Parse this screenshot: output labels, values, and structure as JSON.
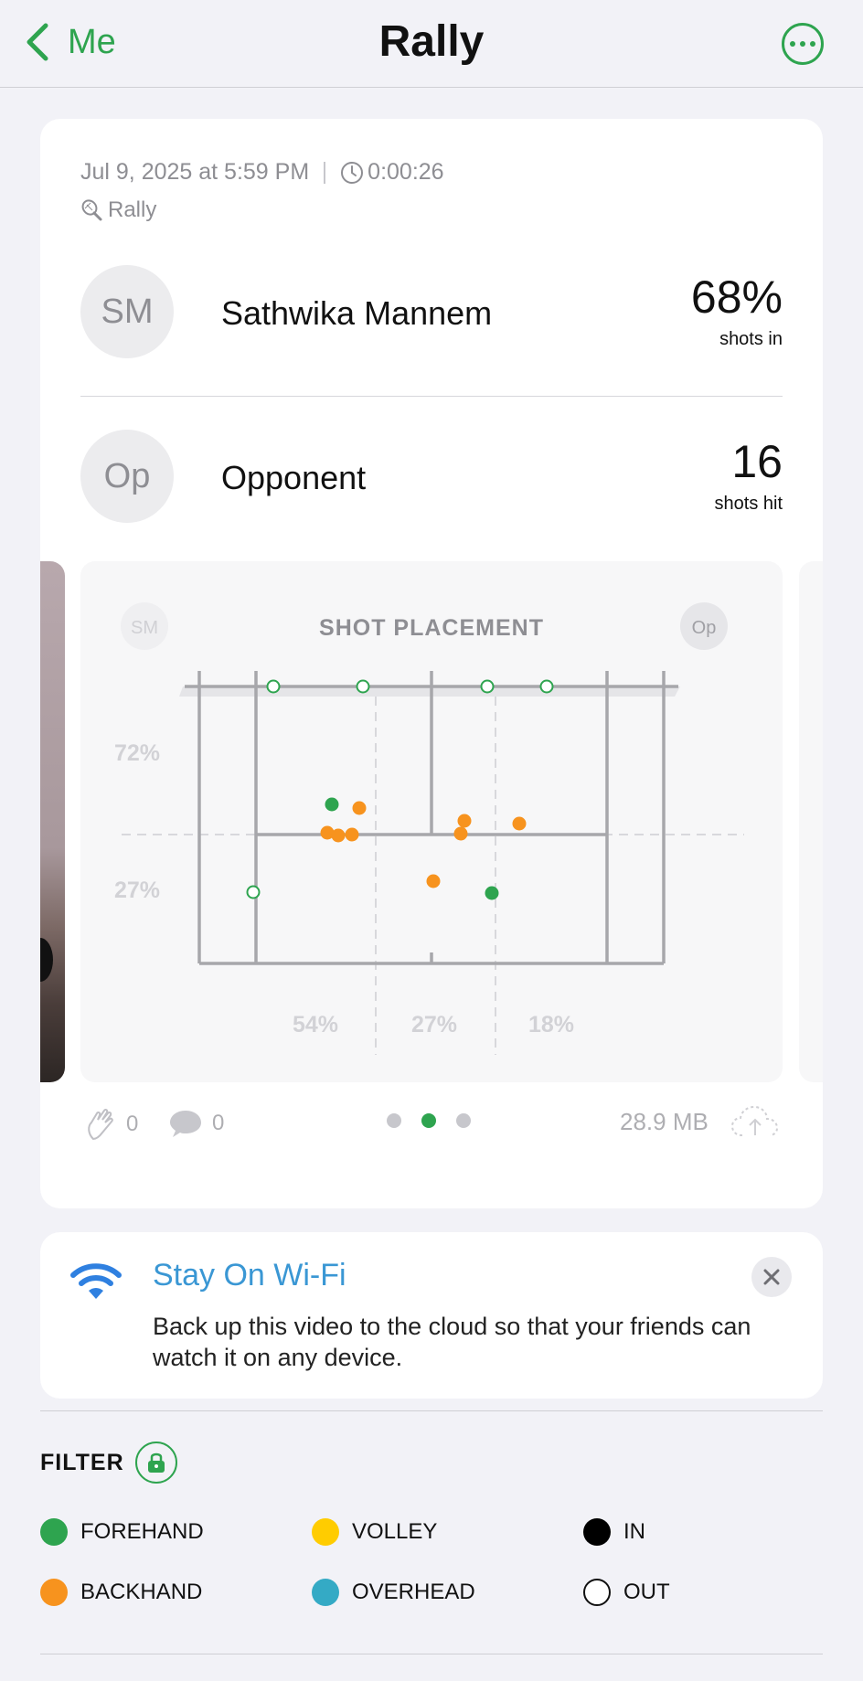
{
  "nav": {
    "back_label": "Me",
    "title": "Rally"
  },
  "session": {
    "datetime": "Jul 9, 2025 at 5:59 PM",
    "duration": "0:00:26",
    "activity": "Rally"
  },
  "players": [
    {
      "initials": "SM",
      "name": "Sathwika Mannem",
      "stat_value": "68%",
      "stat_label": "shots in"
    },
    {
      "initials": "Op",
      "name": "Opponent",
      "stat_value": "16",
      "stat_label": "shots hit"
    }
  ],
  "placement": {
    "title": "SHOT PLACEMENT",
    "left_badge": "SM",
    "right_badge": "Op",
    "row_pcts": [
      "72%",
      "27%"
    ],
    "col_pcts": [
      "54%",
      "27%",
      "18%"
    ],
    "colors": {
      "forehand": "#2ea44f",
      "backhand": "#f7931e"
    }
  },
  "footer": {
    "likes": "0",
    "comments": "0",
    "size": "28.9 MB",
    "pages": 3,
    "active_page": 2
  },
  "banner": {
    "title": "Stay On Wi-Fi",
    "body": "Back up this video to the cloud so that your friends can watch it on any device."
  },
  "filter": {
    "title": "FILTER",
    "items": [
      {
        "label": "FOREHAND",
        "color": "#2ea44f"
      },
      {
        "label": "VOLLEY",
        "color": "#ffcc00"
      },
      {
        "label": "IN",
        "color": "#000000"
      },
      {
        "label": "BACKHAND",
        "color": "#f7931e"
      },
      {
        "label": "OVERHEAD",
        "color": "#34aac5"
      },
      {
        "label": "OUT",
        "color": "none"
      }
    ]
  }
}
